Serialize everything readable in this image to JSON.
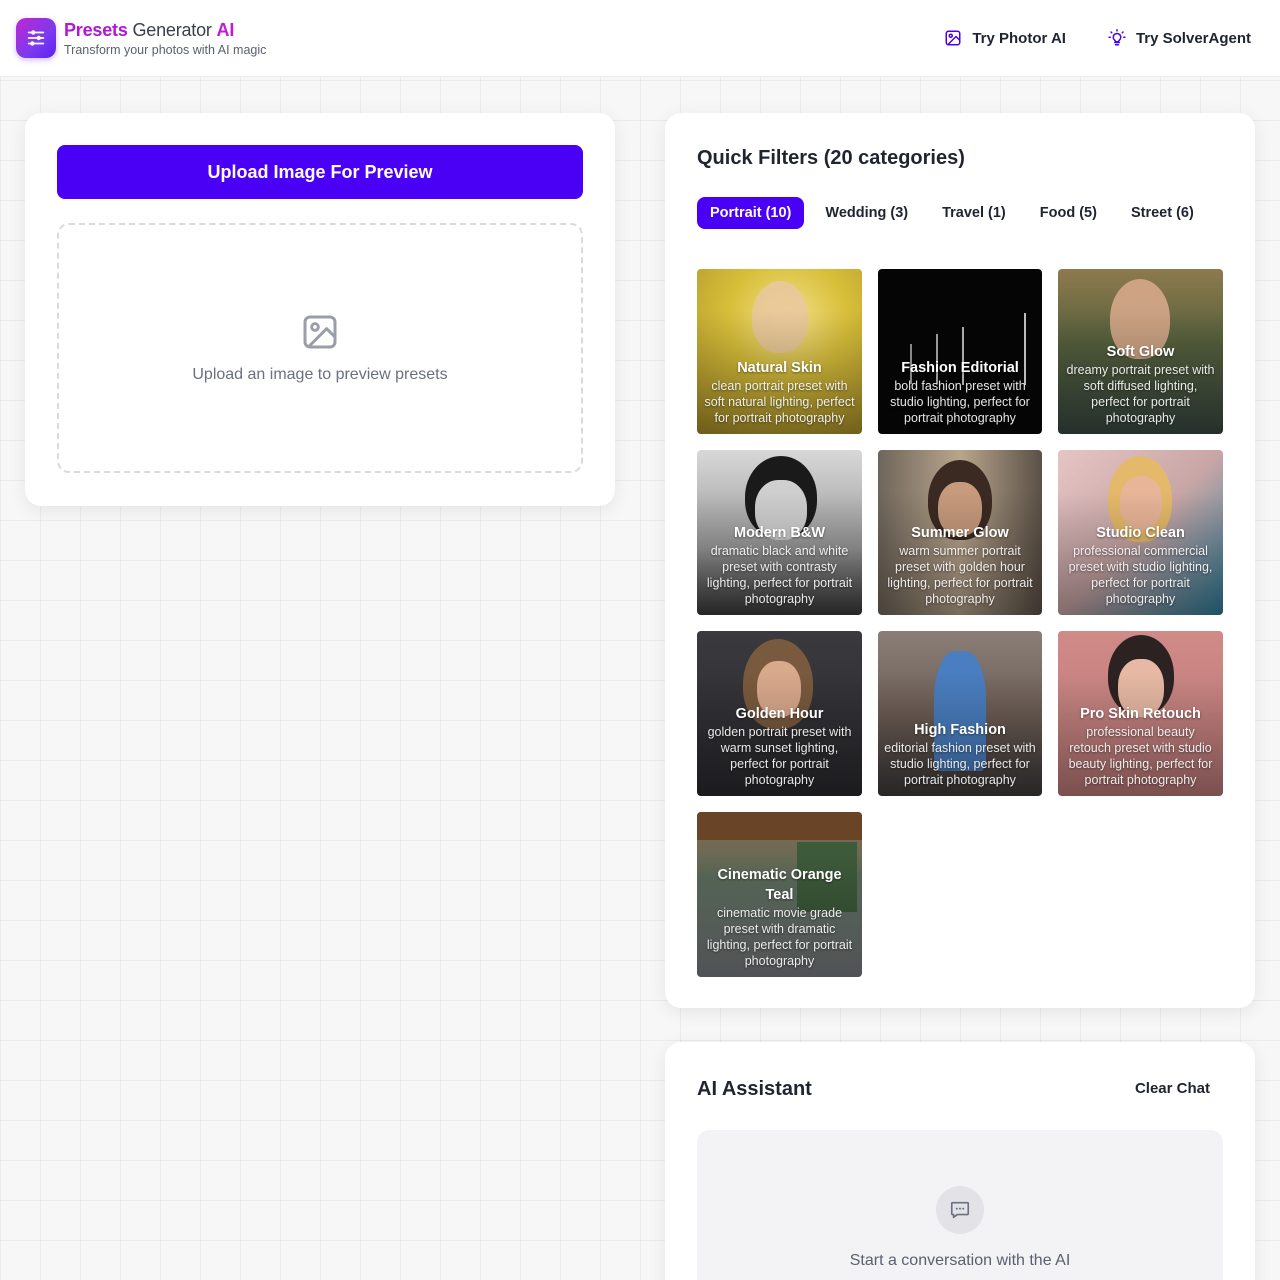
{
  "header": {
    "brand_presets": "Presets",
    "brand_generator": " Generator ",
    "brand_ai": "AI",
    "tagline": "Transform your photos with AI magic",
    "nav": [
      {
        "label": "Try Photor AI",
        "icon": "image-icon"
      },
      {
        "label": "Try SolverAgent",
        "icon": "lightbulb-icon"
      }
    ]
  },
  "upload": {
    "button_label": "Upload Image For Preview",
    "dropzone_text": "Upload an image to preview presets",
    "dropzone_icon": "image-icon"
  },
  "filters": {
    "title": "Quick Filters (20 categories)",
    "tabs": [
      {
        "label": "Portrait (10)",
        "active": true
      },
      {
        "label": "Wedding (3)",
        "active": false
      },
      {
        "label": "Travel (1)",
        "active": false
      },
      {
        "label": "Food (5)",
        "active": false
      },
      {
        "label": "Street (6)",
        "active": false
      }
    ],
    "presets": [
      {
        "name": "Natural Skin",
        "description": "clean portrait preset with soft natural lighting, perfect for portrait photography"
      },
      {
        "name": "Fashion Editorial",
        "description": "bold fashion preset with studio lighting, perfect for portrait photography"
      },
      {
        "name": "Soft Glow",
        "description": "dreamy portrait preset with soft diffused lighting, perfect for portrait photography"
      },
      {
        "name": "Modern B&W",
        "description": "dramatic black and white preset with contrasty lighting, perfect for portrait photography"
      },
      {
        "name": "Summer Glow",
        "description": "warm summer portrait preset with golden hour lighting, perfect for portrait photography"
      },
      {
        "name": "Studio Clean",
        "description": "professional commercial preset with studio lighting, perfect for portrait photography"
      },
      {
        "name": "Golden Hour",
        "description": "golden portrait preset with warm sunset lighting, perfect for portrait photography"
      },
      {
        "name": "High Fashion",
        "description": "editorial fashion preset with studio lighting, perfect for portrait photography"
      },
      {
        "name": "Pro Skin Retouch",
        "description": "professional beauty retouch preset with studio beauty lighting, perfect for portrait photography"
      },
      {
        "name": "Cinematic Orange Teal",
        "description": "cinematic movie grade preset with dramatic lighting, perfect for portrait photography"
      }
    ]
  },
  "assistant": {
    "title": "AI Assistant",
    "clear_label": "Clear Chat",
    "empty_text": "Start a conversation with the AI",
    "empty_icon": "chat-bubble-icon"
  },
  "colors": {
    "accent": "#4a00f5",
    "brand_magenta": "#c21bd6"
  }
}
